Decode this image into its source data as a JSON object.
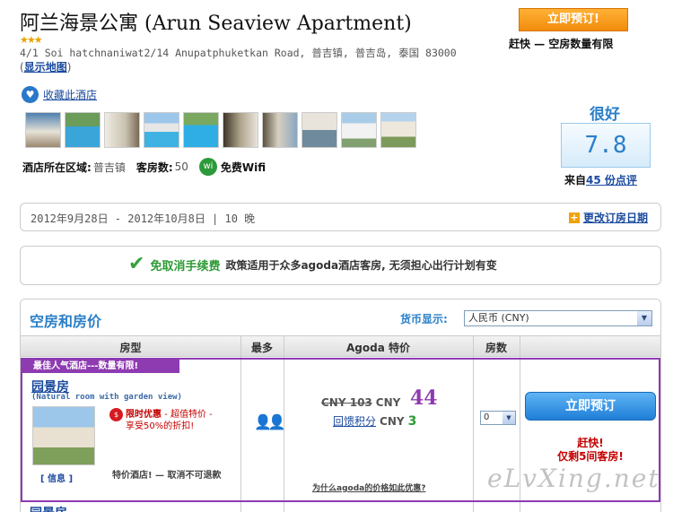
{
  "hotel": {
    "title": "阿兰海景公寓 (Arun Seaview Apartment)",
    "stars": "★★★",
    "address": "4/1 Soi hatchnaniwat2/14 Anupatphuketkan Road, 普吉镇, 普吉岛, 泰国 83000",
    "map_open": "(",
    "map_link": "显示地图",
    "map_close": ")",
    "favorite_label": "收藏此酒店",
    "area_label": "酒店所在区域:",
    "area_value": "普吉镇",
    "rooms_label": "客房数:",
    "rooms_value": "50",
    "wifi_label": "免费Wifi"
  },
  "booking": {
    "top_button": "立即预订!",
    "top_note": "赶快 — 空房数量有限"
  },
  "rating": {
    "word": "很好",
    "score": "7.8",
    "reviews_prefix": "来自",
    "reviews_count": "45 份点评"
  },
  "stay": {
    "dates": "2012年9月28日 - 2012年10月8日 | 10 晚",
    "change_label": "更改订房日期"
  },
  "policy": {
    "title": "免取消手续费",
    "desc": "政策适用于众多agoda酒店客房, 无须担心出行计划有变"
  },
  "rooms_section": {
    "title": "空房和房价",
    "currency_label": "货币显示:",
    "currency_value": "人民币 (CNY)",
    "columns": [
      "房型",
      "最多",
      "Agoda 特价",
      "房数"
    ]
  },
  "room": {
    "badge": "最佳人气酒店---数量有限!",
    "name": "园景房",
    "subtitle": "(Natural room with garden view)",
    "deal_label": "限时优惠",
    "deal_desc": "- 超值特价 -",
    "deal_desc2": "享受50%的折扣!",
    "info_link": "[ 信息 ]",
    "cancel_note": "特价酒店! — 取消不可退款",
    "old_price": "CNY 103",
    "currency": "CNY",
    "new_price": "44",
    "points_label": "回馈积分",
    "points_value": "3",
    "why_link": "为什么agoda的价格如此优惠?",
    "qty": "0",
    "book_button": "立即预订",
    "hurry": "赶快!",
    "hurry2": "仅剩5间客房!"
  },
  "next_room_name": "园景房",
  "watermark": "eLvXing.net",
  "colors": {
    "accent_blue": "#2a7fc8",
    "promo_purple": "#8e3bb2",
    "orange": "#f28c0c",
    "green": "#2d9a35"
  },
  "icons": {
    "favorite": "heart-icon",
    "wifi": "wifi-icon",
    "check": "checkmark-icon",
    "change_dates": "plus-icon",
    "guests": "two-person-icon",
    "deal": "deal-icon"
  }
}
